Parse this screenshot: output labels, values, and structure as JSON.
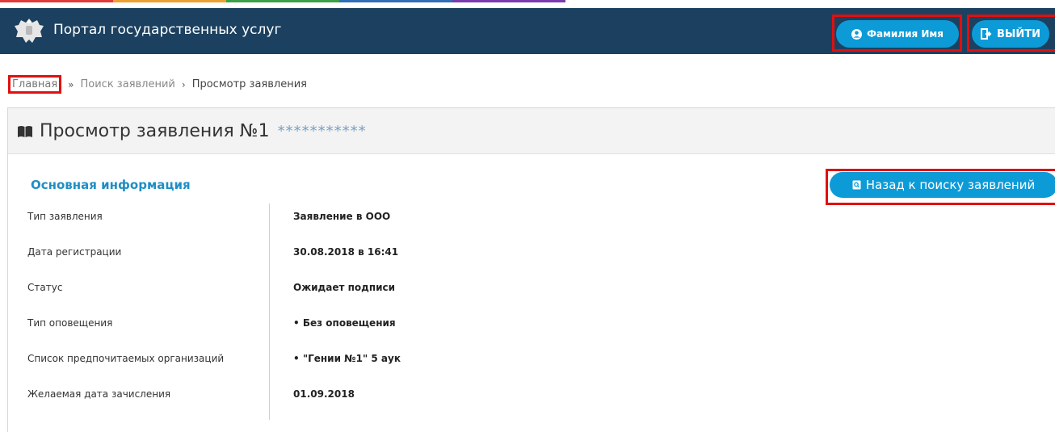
{
  "header": {
    "title": "Портал государственных услуг",
    "user_button": "Фамилия Имя",
    "logout_button": "ВЫЙТИ"
  },
  "breadcrumb": {
    "home": "Главная",
    "sep1": "»",
    "search": "Поиск заявлений",
    "sep2": "›",
    "current": "Просмотр заявления"
  },
  "panel": {
    "title": "Просмотр заявления №1",
    "masked_number": "***********"
  },
  "section": {
    "title": "Основная информация",
    "back_button": "Назад к поиску заявлений"
  },
  "fields": [
    {
      "label": "Тип заявления",
      "value": "Заявление в ООО"
    },
    {
      "label": "Дата регистрации",
      "value": "30.08.2018 в 16:41"
    },
    {
      "label": "Статус",
      "value": "Ожидает подписи"
    },
    {
      "label": "Тип оповещения",
      "value": "•  Без оповещения"
    },
    {
      "label": "Список предпочитаемых организаций",
      "value": "•  \"Гении №1\" 5 аук"
    },
    {
      "label": "Желаемая дата зачисления",
      "value": "01.09.2018"
    }
  ],
  "colors": {
    "header_bg": "#1c4160",
    "button_bg": "#0d9bd8",
    "highlight": "#e01010",
    "section_title": "#1e8fc6"
  }
}
